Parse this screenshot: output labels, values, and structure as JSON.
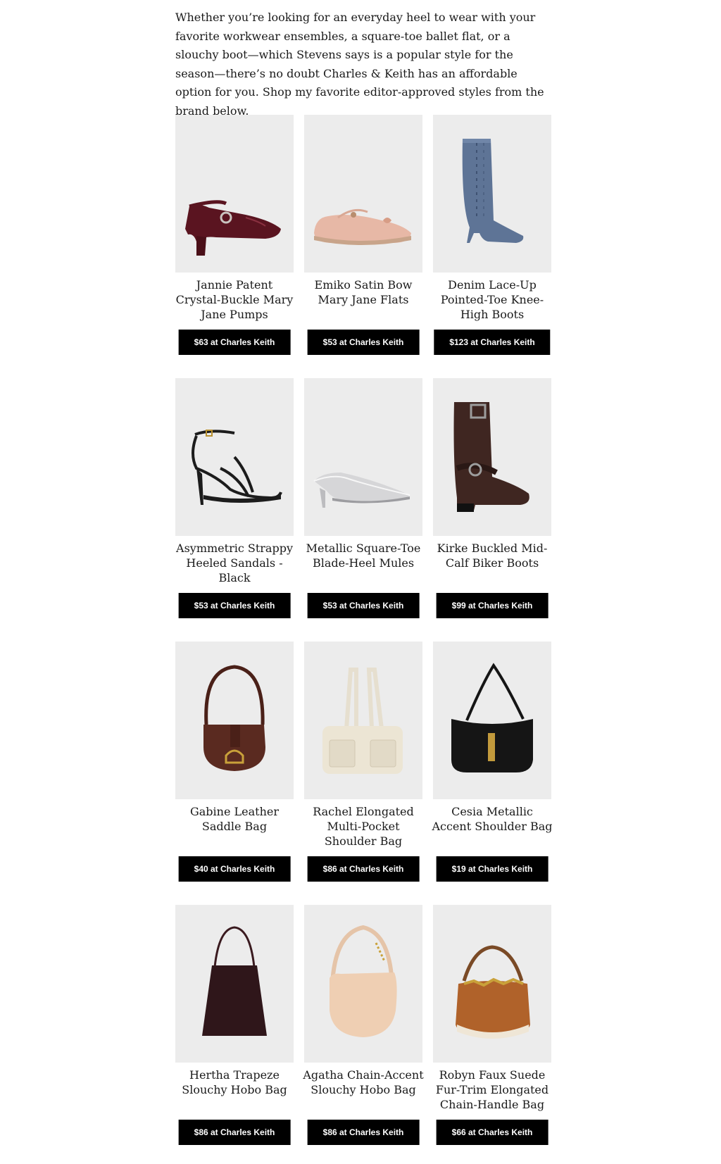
{
  "intro": "Whether you’re looking for an everyday heel to wear with your favorite workwear ensembles, a square-toe ballet flat, or a slouchy boot—which Stevens says is a popular style for the season—there’s no doubt Charles & Keith has an affordable option for you. Shop my favorite editor-approved styles from the brand below.",
  "products": [
    {
      "title": "Jannie Patent Crystal-Buckle Mary Jane Pumps",
      "button": "$63 at Charles Keith",
      "image_icon": "burgundy-mary-jane-pump-icon"
    },
    {
      "title": "Emiko Satin Bow Mary Jane Flats",
      "button": "$53 at Charles Keith",
      "image_icon": "pink-satin-flat-icon"
    },
    {
      "title": "Denim Lace-Up Pointed-Toe Knee-High Boots",
      "button": "$123 at Charles Keith",
      "image_icon": "denim-knee-boot-icon"
    },
    {
      "title": "Asymmetric Strappy Heeled Sandals - Black",
      "button": "$53 at Charles Keith",
      "image_icon": "black-strappy-sandal-icon"
    },
    {
      "title": "Metallic Square-Toe Blade-Heel Mules",
      "button": "$53 at Charles Keith",
      "image_icon": "silver-mule-icon"
    },
    {
      "title": "Kirke Buckled Mid-Calf Biker Boots",
      "button": "$99 at Charles Keith",
      "image_icon": "brown-biker-boot-icon"
    },
    {
      "title": "Gabine Leather Saddle Bag",
      "button": "$40 at Charles Keith",
      "image_icon": "brown-saddle-bag-icon"
    },
    {
      "title": "Rachel Elongated Multi-Pocket Shoulder Bag",
      "button": "$86 at Charles Keith",
      "image_icon": "cream-shoulder-bag-icon"
    },
    {
      "title": "Cesia Metallic Accent Shoulder Bag",
      "button": "$19 at Charles Keith",
      "image_icon": "black-shoulder-bag-icon"
    },
    {
      "title": "Hertha Trapeze Slouchy Hobo Bag",
      "button": "$86 at Charles Keith",
      "image_icon": "plum-hobo-bag-icon"
    },
    {
      "title": "Agatha Chain-Accent Slouchy Hobo Bag",
      "button": "$86 at Charles Keith",
      "image_icon": "beige-hobo-bag-icon"
    },
    {
      "title": "Robyn Faux Suede Fur-Trim Elongated Chain-Handle Bag",
      "button": "$66 at Charles Keith",
      "image_icon": "tan-suede-chain-bag-icon"
    }
  ],
  "colors": {
    "image_bg": "#ececec",
    "button_bg": "#000000",
    "button_text": "#ffffff",
    "body_text": "#1a1a1a"
  }
}
